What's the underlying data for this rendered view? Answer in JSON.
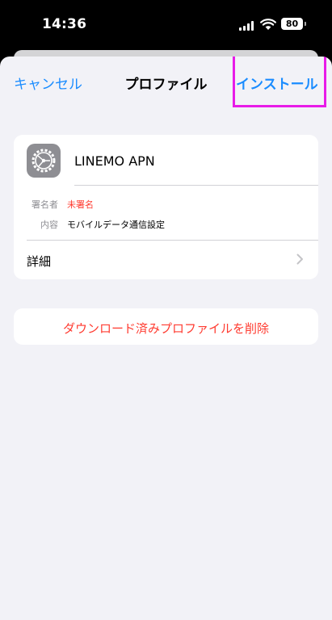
{
  "status_bar": {
    "time": "14:36",
    "battery_level": "80",
    "icons": [
      "signal-icon",
      "wifi-icon",
      "battery-icon"
    ]
  },
  "nav": {
    "cancel_label": "キャンセル",
    "title": "プロファイル",
    "install_label": "インストール"
  },
  "profile": {
    "icon": "settings-gear-icon",
    "name": "LINEMO APN",
    "signer_label": "署名者",
    "signer_value": "未署名",
    "content_label": "内容",
    "content_value": "モバイルデータ通信設定",
    "details_label": "詳細"
  },
  "actions": {
    "delete_label": "ダウンロード済みプロファイルを削除"
  },
  "colors": {
    "accent": "#1a8cff",
    "destructive": "#ff3b30",
    "background": "#f2f2f7",
    "highlight": "#e81be8"
  }
}
